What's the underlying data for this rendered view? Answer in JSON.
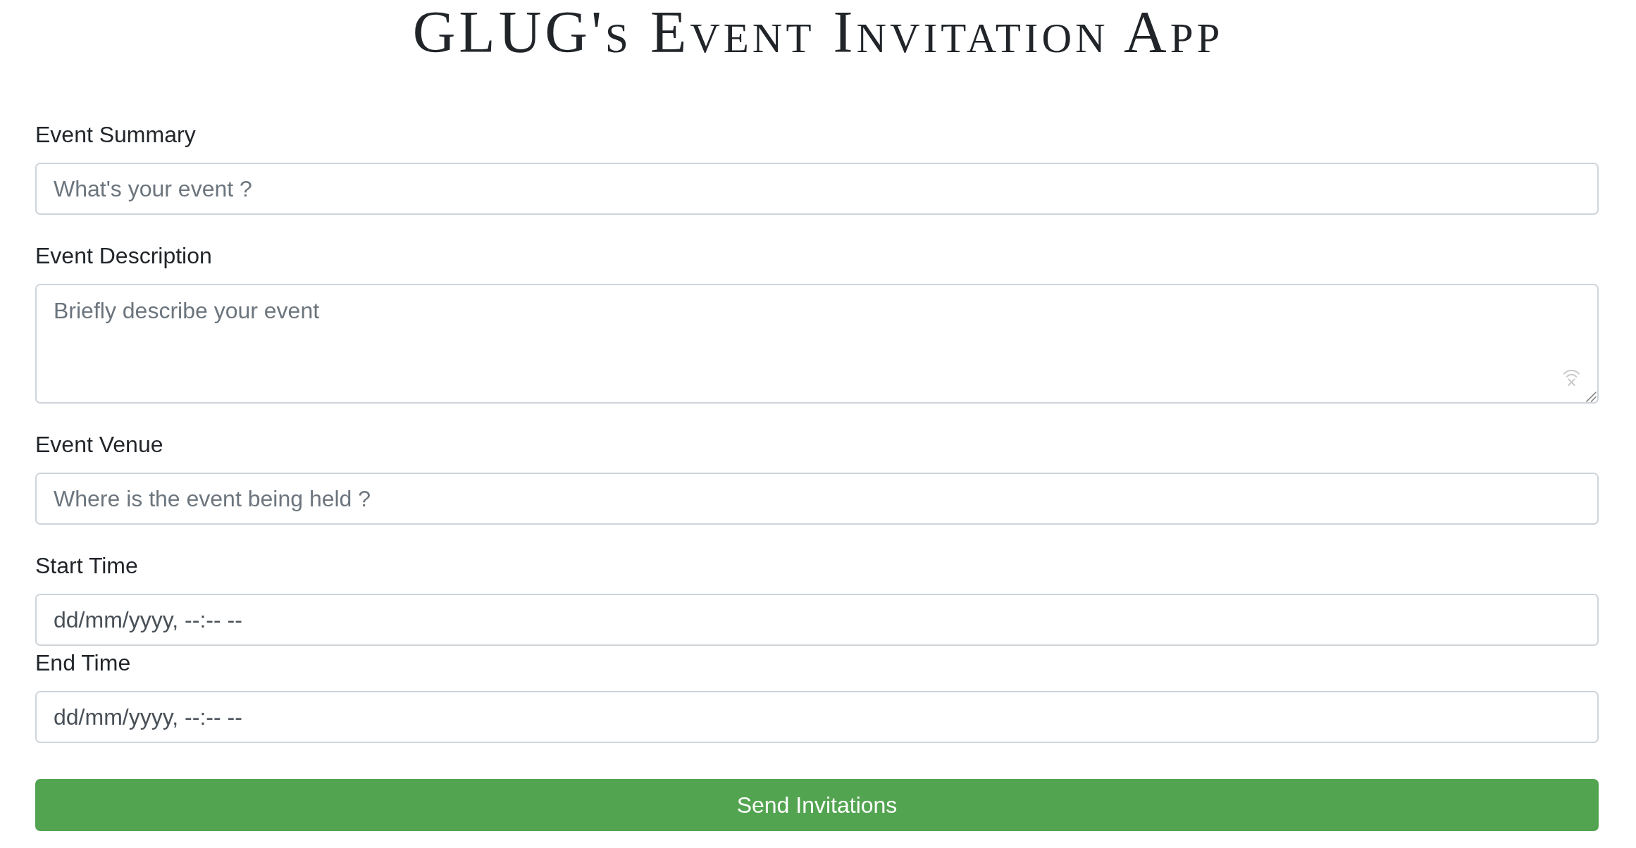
{
  "title": "GLUG's Event Invitation App",
  "fields": [
    {
      "kind": "text",
      "label": "Event Summary",
      "placeholder": "What's your event ?"
    },
    {
      "kind": "textarea",
      "label": "Event Description",
      "placeholder": "Briefly describe your event"
    },
    {
      "kind": "text",
      "label": "Event Venue",
      "placeholder": "Where is the event being held ?"
    },
    {
      "kind": "datetime",
      "label": "Start Time",
      "placeholder": "dd/mm/yyyy, --:-- --"
    },
    {
      "kind": "datetime",
      "label": "End Time",
      "placeholder": "dd/mm/yyyy, --:-- --"
    }
  ],
  "submit_button": "Send Invitations"
}
